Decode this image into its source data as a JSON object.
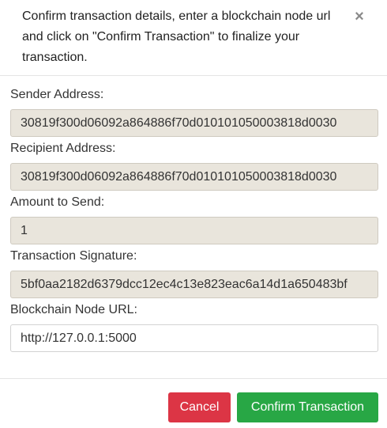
{
  "header": {
    "title": "Confirm transaction details, enter a blockchain node url and click on \"Confirm Transaction\" to finalize your transaction.",
    "close_symbol": "×"
  },
  "form": {
    "sender": {
      "label": "Sender Address:",
      "value": "30819f300d06092a864886f70d010101050003818d0030"
    },
    "recipient": {
      "label": "Recipient Address:",
      "value": "30819f300d06092a864886f70d010101050003818d0030"
    },
    "amount": {
      "label": "Amount to Send:",
      "value": "1"
    },
    "signature": {
      "label": "Transaction Signature:",
      "value": "5bf0aa2182d6379dcc12ec4c13e823eac6a14d1a650483bf"
    },
    "node_url": {
      "label": "Blockchain Node URL:",
      "value": "http://127.0.0.1:5000"
    }
  },
  "footer": {
    "cancel_label": "Cancel",
    "confirm_label": "Confirm Transaction"
  },
  "colors": {
    "cancel": "#dc3545",
    "confirm": "#28a745",
    "readonly_input_bg": "#e9e5dc"
  }
}
